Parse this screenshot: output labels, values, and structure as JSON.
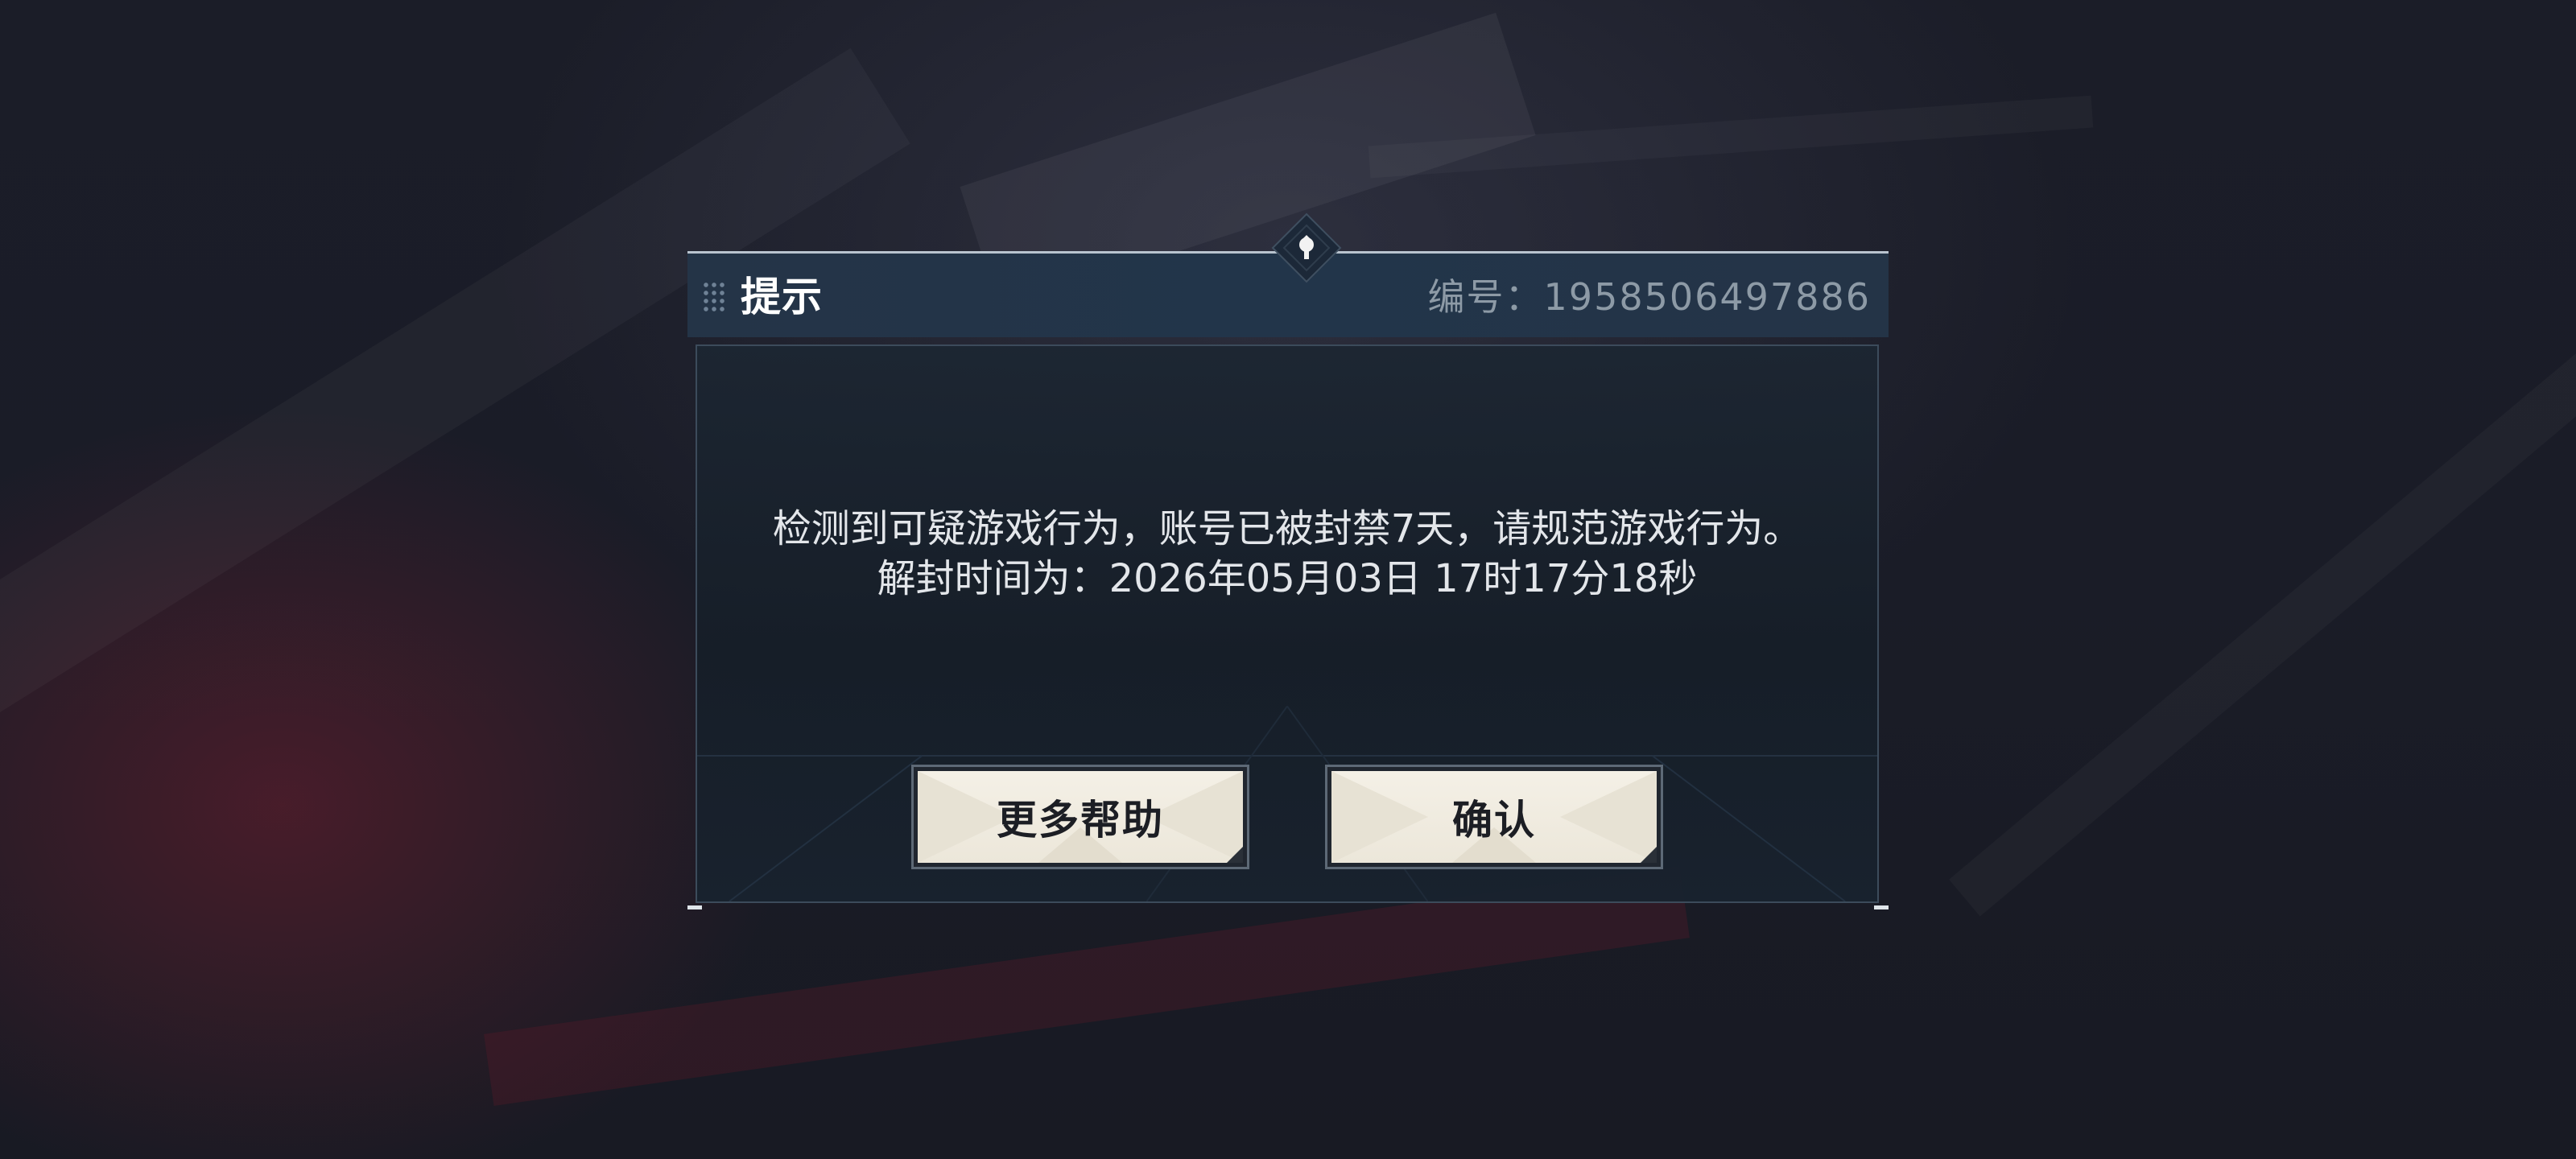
{
  "dialog": {
    "title": "提示",
    "id_text": "编号：1958506497886",
    "message_line1": "检测到可疑游戏行为，账号已被封禁7天，请规范游戏行为。",
    "message_line2": "解封时间为：2026年05月03日 17时17分18秒"
  },
  "buttons": {
    "help_label": "更多帮助",
    "confirm_label": "确认"
  },
  "colors": {
    "header_bg": "#243447",
    "title_text": "#ffffff",
    "id_text": "#8d9aa6",
    "message_text": "#e3e6ea",
    "button_bg": "#f4f0e6",
    "button_text": "#1c1e24"
  },
  "icons": {
    "grip": "grip-dots-icon",
    "crest": "crest-emblem-icon"
  }
}
